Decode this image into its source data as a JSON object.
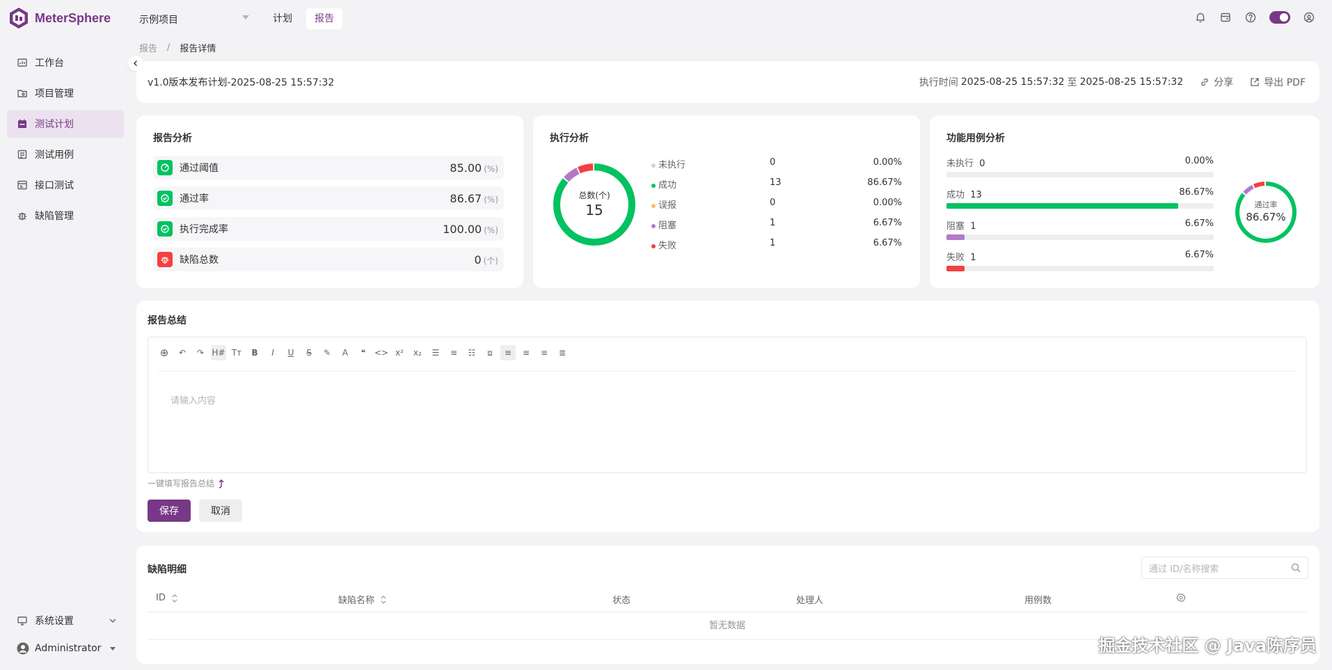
{
  "app": {
    "name": "MeterSphere"
  },
  "header": {
    "project": "示例项目",
    "nav": [
      {
        "label": "计划",
        "active": false
      },
      {
        "label": "报告",
        "active": true
      }
    ]
  },
  "sidebar": {
    "items": [
      {
        "label": "工作台",
        "icon": "workbench-icon"
      },
      {
        "label": "项目管理",
        "icon": "project-icon"
      },
      {
        "label": "测试计划",
        "icon": "test-plan-icon",
        "active": true
      },
      {
        "label": "测试用例",
        "icon": "test-case-icon"
      },
      {
        "label": "接口测试",
        "icon": "api-test-icon"
      },
      {
        "label": "缺陷管理",
        "icon": "bug-icon"
      }
    ],
    "settings": "系统设置",
    "user": "Administrator"
  },
  "breadcrumb": {
    "parent": "报告",
    "separator": "/",
    "current": "报告详情"
  },
  "report": {
    "title": "v1.0版本发布计划-2025-08-25 15:57:32",
    "exec_time_label": "执行时间",
    "exec_start": "2025-08-25 15:57:32",
    "exec_to": "至",
    "exec_end": "2025-08-25 15:57:32",
    "share": "分享",
    "export": "导出 PDF"
  },
  "analysis": {
    "title": "报告分析",
    "metrics": [
      {
        "label": "通过阈值",
        "value": "85.00",
        "unit": "(%)",
        "color": "#00c261"
      },
      {
        "label": "通过率",
        "value": "86.67",
        "unit": "(%)",
        "color": "#00c261"
      },
      {
        "label": "执行完成率",
        "value": "100.00",
        "unit": "(%)",
        "color": "#00c261"
      },
      {
        "label": "缺陷总数",
        "value": "0",
        "unit": "(个)",
        "color": "#f53f3f"
      }
    ]
  },
  "execution": {
    "title": "执行分析",
    "total_label": "总数(个)",
    "total": "15",
    "rows": [
      {
        "label": "未执行",
        "count": "0",
        "pct": "0.00%",
        "color": "#d4d4d8",
        "value": 0
      },
      {
        "label": "成功",
        "count": "13",
        "pct": "86.67%",
        "color": "#00c261",
        "value": 13
      },
      {
        "label": "误报",
        "count": "0",
        "pct": "0.00%",
        "color": "#ffc14e",
        "value": 0
      },
      {
        "label": "阻塞",
        "count": "1",
        "pct": "6.67%",
        "color": "#b379c8",
        "value": 1
      },
      {
        "label": "失败",
        "count": "1",
        "pct": "6.67%",
        "color": "#f53f3f",
        "value": 1
      }
    ]
  },
  "functional": {
    "title": "功能用例分析",
    "rate_label": "通过率",
    "rate": "86.67%",
    "bars": [
      {
        "label": "未执行",
        "count": "0",
        "pct": "0.00%",
        "fraction": 0,
        "color": "#d4d4d8"
      },
      {
        "label": "成功",
        "count": "13",
        "pct": "86.67%",
        "fraction": 0.8667,
        "color": "#00c261"
      },
      {
        "label": "阻塞",
        "count": "1",
        "pct": "6.67%",
        "fraction": 0.0667,
        "color": "#b379c8"
      },
      {
        "label": "失败",
        "count": "1",
        "pct": "6.67%",
        "fraction": 0.0667,
        "color": "#f53f3f"
      }
    ]
  },
  "summary": {
    "title": "报告总结",
    "placeholder": "请输入内容",
    "one_click": "一键填写报告总结",
    "save": "保存",
    "cancel": "取消",
    "toolbar": [
      "add-icon",
      "undo-icon",
      "redo-icon",
      "heading-icon",
      "font-size-icon",
      "bold-icon",
      "italic-icon",
      "underline-icon",
      "strikethrough-icon",
      "highlight-icon",
      "font-color-icon",
      "quote-icon",
      "code-icon",
      "superscript-icon",
      "subscript-icon",
      "bullet-list-icon",
      "ordered-list-icon",
      "task-list-icon",
      "code-block-icon",
      "align-left-icon",
      "align-center-icon",
      "align-right-icon",
      "align-justify-icon"
    ]
  },
  "defects": {
    "title": "缺陷明细",
    "search_placeholder": "通过 ID/名称搜索",
    "columns": [
      "ID",
      "缺陷名称",
      "状态",
      "处理人",
      "用例数"
    ],
    "empty": "暂无数据"
  },
  "watermark": "掘金技术社区 @ Java陈序员",
  "colors": {
    "brand": "#783887",
    "success": "#00c261",
    "danger": "#f53f3f",
    "blocked": "#b379c8",
    "pending": "#d4d4d8"
  }
}
